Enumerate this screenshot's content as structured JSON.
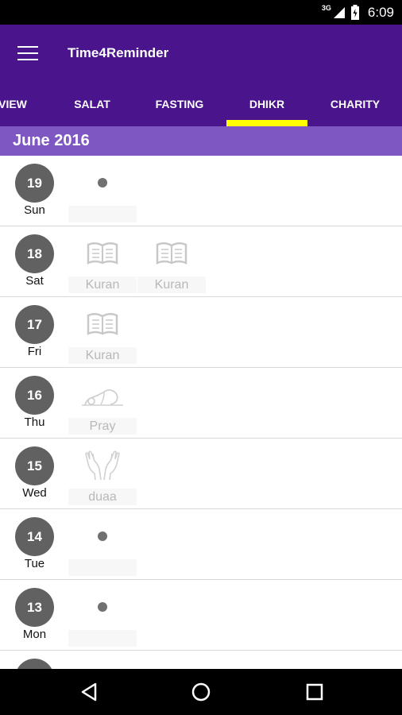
{
  "status_bar": {
    "network_label": "3G",
    "time": "6:09"
  },
  "app_bar": {
    "title": "Time4Reminder"
  },
  "tabs": [
    {
      "label": "VIEW",
      "active": false
    },
    {
      "label": "SALAT",
      "active": false
    },
    {
      "label": "FASTING",
      "active": false
    },
    {
      "label": "DHIKR",
      "active": true
    },
    {
      "label": "CHARITY",
      "active": false
    }
  ],
  "colors": {
    "app_bar": "#4a148c",
    "month_header": "#7e57c2",
    "tab_indicator": "#ffff00",
    "day_circle": "#616161"
  },
  "month_header": "June 2016",
  "days": [
    {
      "date": "19",
      "weekday": "Sun",
      "entries": [
        {
          "icon": "dot-icon",
          "label": ""
        }
      ]
    },
    {
      "date": "18",
      "weekday": "Sat",
      "entries": [
        {
          "icon": "book-icon",
          "label": "Kuran"
        },
        {
          "icon": "book-icon",
          "label": "Kuran"
        }
      ]
    },
    {
      "date": "17",
      "weekday": "Fri",
      "entries": [
        {
          "icon": "book-icon",
          "label": "Kuran"
        }
      ]
    },
    {
      "date": "16",
      "weekday": "Thu",
      "entries": [
        {
          "icon": "prostration-icon",
          "label": "Pray"
        }
      ]
    },
    {
      "date": "15",
      "weekday": "Wed",
      "entries": [
        {
          "icon": "praying-hands-icon",
          "label": "duaa"
        }
      ]
    },
    {
      "date": "14",
      "weekday": "Tue",
      "entries": [
        {
          "icon": "dot-icon",
          "label": ""
        }
      ]
    },
    {
      "date": "13",
      "weekday": "Mon",
      "entries": [
        {
          "icon": "dot-icon",
          "label": ""
        }
      ]
    },
    {
      "date": "",
      "weekday": "",
      "entries": []
    }
  ],
  "nav_bar": {
    "back": "back-icon",
    "home": "home-icon",
    "recents": "recents-icon"
  }
}
